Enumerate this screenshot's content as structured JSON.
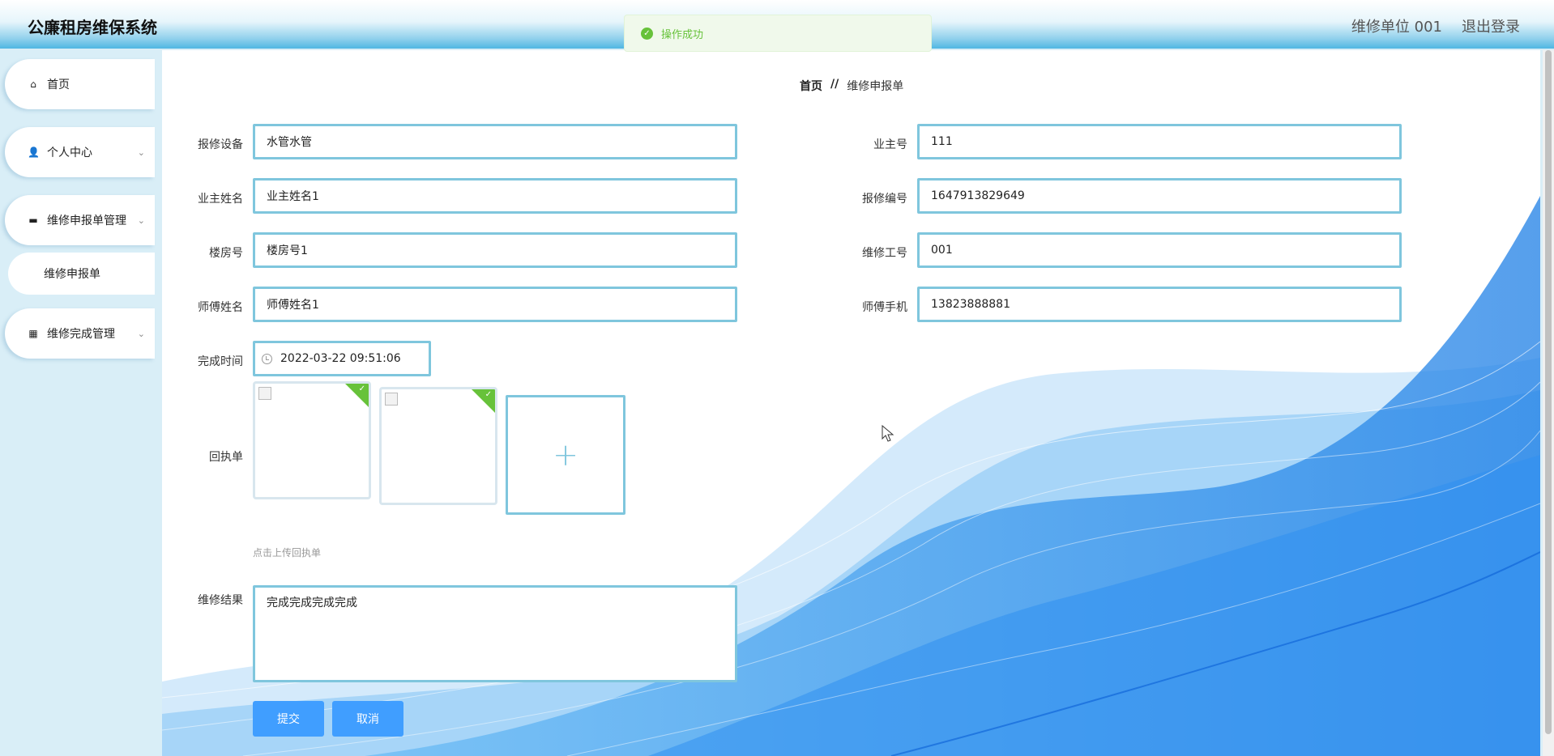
{
  "header": {
    "title": "公廉租房维保系统",
    "user": "维修单位 001",
    "logout": "退出登录"
  },
  "toast": {
    "message": "操作成功",
    "icon": "success-check-icon"
  },
  "sidebar": {
    "items": [
      {
        "label": "首页",
        "icon": "home-icon"
      },
      {
        "label": "个人中心",
        "icon": "user-icon"
      },
      {
        "label": "维修申报单管理",
        "icon": "message-icon"
      },
      {
        "label": "维修申报单",
        "icon": ""
      },
      {
        "label": "维修完成管理",
        "icon": "grid-icon"
      }
    ]
  },
  "breadcrumb": {
    "home": "首页",
    "separator": "//",
    "current": "维修申报单"
  },
  "form": {
    "device_label": "报修设备",
    "device_value": "水管水管",
    "owner_no_label": "业主号",
    "owner_no_value": "111",
    "owner_name_label": "业主姓名",
    "owner_name_value": "业主姓名1",
    "repair_no_label": "报修编号",
    "repair_no_value": "1647913829649",
    "building_label": "楼房号",
    "building_value": "楼房号1",
    "worker_id_label": "维修工号",
    "worker_id_value": "001",
    "master_name_label": "师傅姓名",
    "master_name_value": "师傅姓名1",
    "master_phone_label": "师傅手机",
    "master_phone_value": "13823888881",
    "finish_time_label": "完成时间",
    "finish_time_value": "2022-03-22 09:51:06",
    "receipt_label": "回执单",
    "receipt_hint": "点击上传回执单",
    "result_label": "维修结果",
    "result_value": "完成完成完成完成",
    "submit": "提交",
    "cancel": "取消"
  },
  "colors": {
    "accent": "#409eff",
    "field_border": "#7fc6dd",
    "success": "#67c23a"
  }
}
